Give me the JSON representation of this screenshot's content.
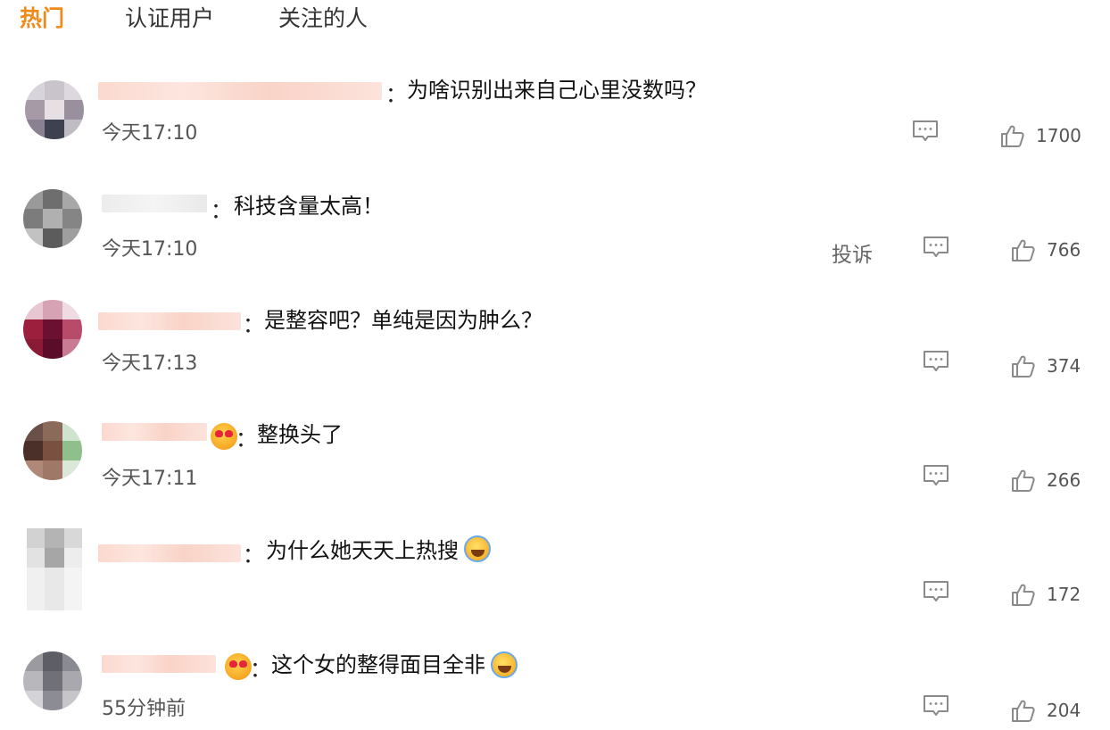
{
  "tabs": [
    {
      "label": "热门",
      "active": true
    },
    {
      "label": "认证用户",
      "active": false
    },
    {
      "label": "关注的人",
      "active": false
    }
  ],
  "colon": "：",
  "actions": {
    "report": "投诉"
  },
  "comments": [
    {
      "text": "为啥识别出来自己心里没数吗？",
      "time": "今天17:10",
      "likes": "1700"
    },
    {
      "text": "科技含量太高！",
      "time": "今天17:10",
      "likes": "766"
    },
    {
      "text": "是整容吧？单纯是因为肿么？",
      "time": "今天17:13",
      "likes": "374"
    },
    {
      "text": "整换头了",
      "time": "今天17:11",
      "likes": "266",
      "emoji": "love-eyes"
    },
    {
      "text": "为什么她天天上热搜",
      "time": "",
      "likes": "172",
      "emoji_after": "laugh-cry"
    },
    {
      "text": "这个女的整得面目全非",
      "time": "55分钟前",
      "likes": "204",
      "emoji": "love-eyes",
      "emoji_after": "laugh-cry"
    }
  ],
  "colors": {
    "active_tab": "#f08a1a",
    "text": "#222222",
    "meta": "#555555",
    "icon": "#8a8a8a"
  }
}
